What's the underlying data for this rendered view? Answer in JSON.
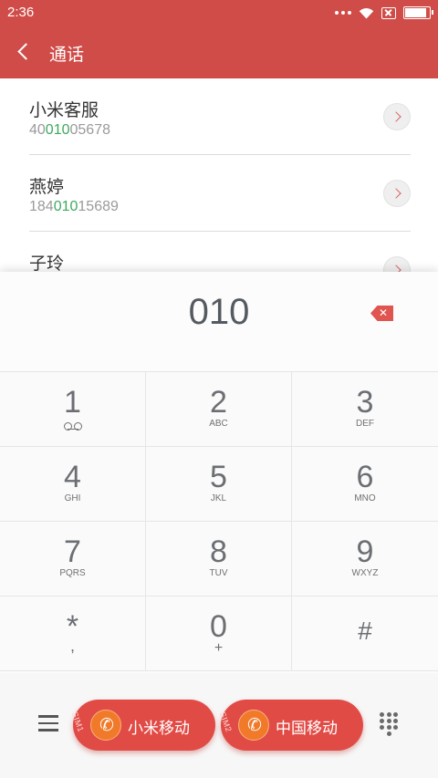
{
  "status": {
    "time": "2:36"
  },
  "header": {
    "title": "通话"
  },
  "results": [
    {
      "name": "小米客服",
      "number_pre": "40",
      "number_match": "010",
      "number_post": "05678"
    },
    {
      "name": "燕婷",
      "number_pre": "184",
      "number_match": "010",
      "number_post": "15689"
    },
    {
      "name": "子玲"
    }
  ],
  "dialer": {
    "input": "010"
  },
  "keypad": [
    {
      "digit": "1",
      "letters": ""
    },
    {
      "digit": "2",
      "letters": "ABC"
    },
    {
      "digit": "3",
      "letters": "DEF"
    },
    {
      "digit": "4",
      "letters": "GHI"
    },
    {
      "digit": "5",
      "letters": "JKL"
    },
    {
      "digit": "6",
      "letters": "MNO"
    },
    {
      "digit": "7",
      "letters": "PQRS"
    },
    {
      "digit": "8",
      "letters": "TUV"
    },
    {
      "digit": "9",
      "letters": "WXYZ"
    },
    {
      "digit": "*",
      "letters": ","
    },
    {
      "digit": "0",
      "letters": "+"
    },
    {
      "digit": "#",
      "letters": ""
    }
  ],
  "actions": {
    "sim1": {
      "tag": "SIM1",
      "carrier": "小米移动"
    },
    "sim2": {
      "tag": "SIM2",
      "carrier": "中国移动"
    }
  },
  "icons": {
    "back": "back-arrow-icon",
    "delete": "backspace-icon",
    "menu": "hamburger-menu-icon",
    "call": "phone-icon",
    "dialpad": "dialpad-grid-icon",
    "voicemail": "voicemail-icon"
  },
  "colors": {
    "header": "#cf4c48",
    "match_highlight": "#3caa5e",
    "call_button": "#e14b46",
    "call_icon": "#f07a2a",
    "delete": "#e05550"
  }
}
